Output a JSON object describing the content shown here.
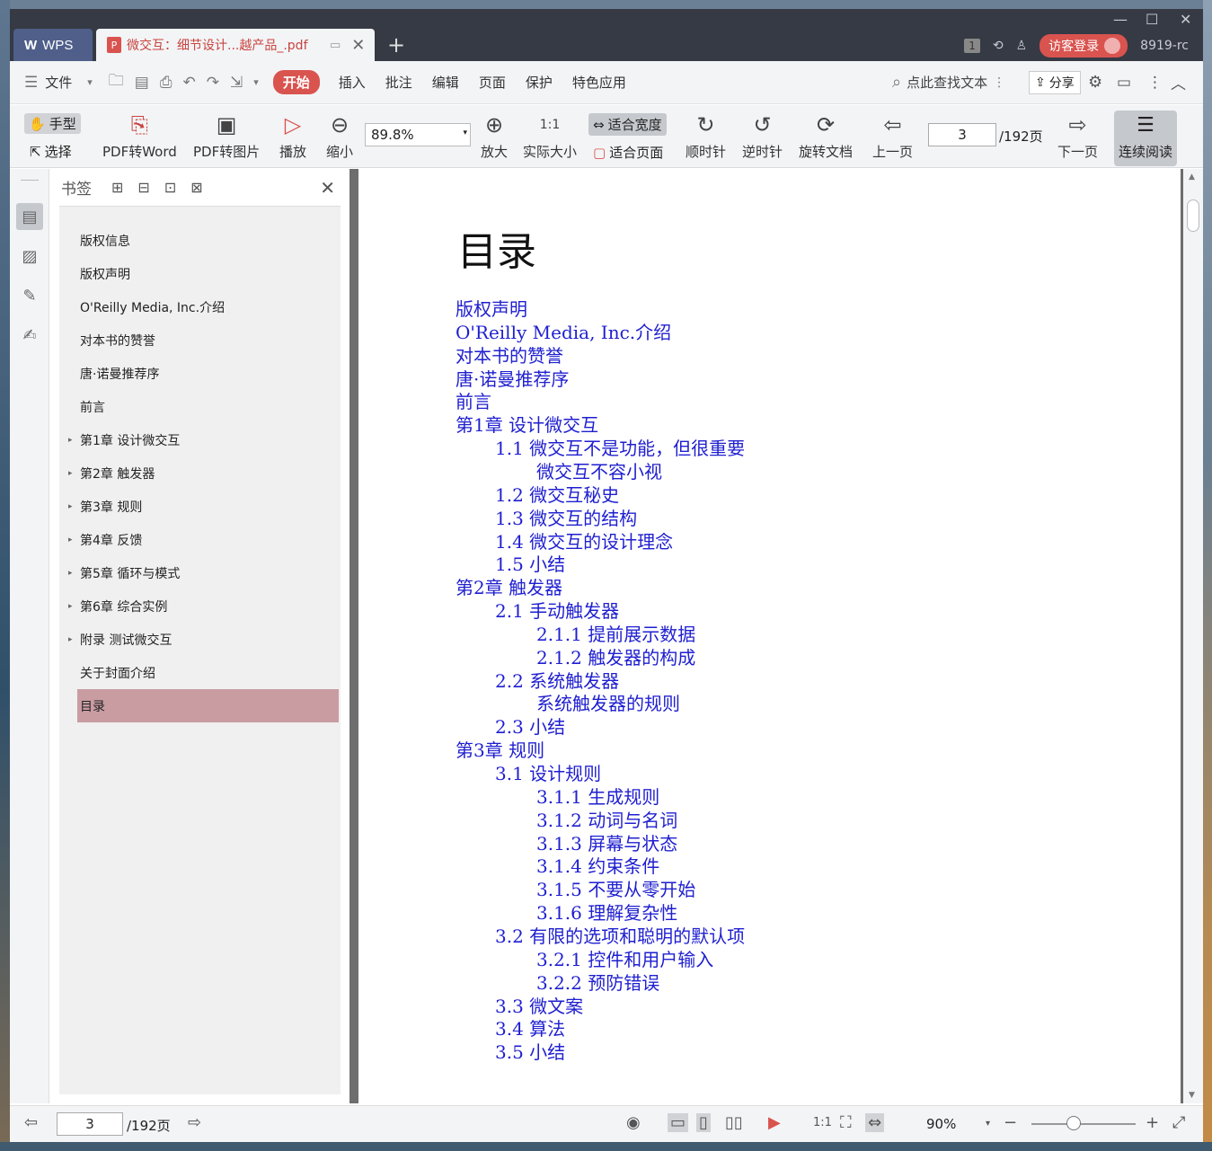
{
  "titlebar": {
    "wps_tab": "WPS",
    "doc_tab": "微交互：细节设计...越产品_.pdf",
    "badge": "1",
    "login": "访客登录",
    "version": "8919-rc"
  },
  "menu": {
    "file": "文件",
    "tabs": [
      "开始",
      "插入",
      "批注",
      "编辑",
      "页面",
      "保护",
      "特色应用"
    ],
    "search": "点此查找文本",
    "share": "分享"
  },
  "toolbar": {
    "hand": "手型",
    "select": "选择",
    "pdf_to_word": "PDF转Word",
    "pdf_to_image": "PDF转图片",
    "play": "播放",
    "zoom_out": "缩小",
    "zoom_value": "89.8%",
    "zoom_in": "放大",
    "actual_size": "实际大小",
    "fit_width": "适合宽度",
    "fit_page": "适合页面",
    "clockwise": "顺时针",
    "counterclockwise": "逆时针",
    "rotate_doc": "旋转文档",
    "prev_page": "上一页",
    "page_current": "3",
    "page_total": "/192页",
    "next_page": "下一页",
    "continuous": "连续阅读"
  },
  "bookmarks": {
    "title": "书签",
    "items": [
      {
        "label": "版权信息",
        "expandable": false
      },
      {
        "label": "版权声明",
        "expandable": false
      },
      {
        "label": "O'Reilly Media, Inc.介绍",
        "expandable": false
      },
      {
        "label": "对本书的赞誉",
        "expandable": false
      },
      {
        "label": "唐·诺曼推荐序",
        "expandable": false
      },
      {
        "label": "前言",
        "expandable": false
      },
      {
        "label": "第1章 设计微交互",
        "expandable": true
      },
      {
        "label": "第2章 触发器",
        "expandable": true
      },
      {
        "label": "第3章 规则",
        "expandable": true
      },
      {
        "label": "第4章 反馈",
        "expandable": true
      },
      {
        "label": "第5章 循环与模式",
        "expandable": true
      },
      {
        "label": "第6章 综合实例",
        "expandable": true
      },
      {
        "label": "附录 测试微交互",
        "expandable": true
      },
      {
        "label": "关于封面介绍",
        "expandable": false
      },
      {
        "label": "目录",
        "expandable": false,
        "selected": true
      }
    ]
  },
  "document": {
    "title": "目录",
    "toc": [
      {
        "text": "版权声明",
        "level": 0
      },
      {
        "text": "O'Reilly Media, Inc.介绍",
        "level": 0
      },
      {
        "text": "对本书的赞誉",
        "level": 0
      },
      {
        "text": "唐·诺曼推荐序",
        "level": 0
      },
      {
        "text": "前言",
        "level": 0
      },
      {
        "text": "第1章 设计微交互",
        "level": 0
      },
      {
        "text": "1.1 微交互不是功能，但很重要",
        "level": 1
      },
      {
        "text": "微交互不容小视",
        "level": 2
      },
      {
        "text": "1.2 微交互秘史",
        "level": 1
      },
      {
        "text": "1.3 微交互的结构",
        "level": 1
      },
      {
        "text": "1.4 微交互的设计理念",
        "level": 1
      },
      {
        "text": "1.5 小结",
        "level": 1
      },
      {
        "text": "第2章 触发器",
        "level": 0
      },
      {
        "text": "2.1 手动触发器",
        "level": 1
      },
      {
        "text": "2.1.1 提前展示数据",
        "level": 2
      },
      {
        "text": "2.1.2 触发器的构成",
        "level": 2
      },
      {
        "text": "2.2 系统触发器",
        "level": 1
      },
      {
        "text": "系统触发器的规则",
        "level": 2
      },
      {
        "text": "2.3 小结",
        "level": 1
      },
      {
        "text": "第3章 规则",
        "level": 0
      },
      {
        "text": "3.1 设计规则",
        "level": 1
      },
      {
        "text": "3.1.1 生成规则",
        "level": 2
      },
      {
        "text": "3.1.2 动词与名词",
        "level": 2
      },
      {
        "text": "3.1.3 屏幕与状态",
        "level": 2
      },
      {
        "text": "3.1.4 约束条件",
        "level": 2
      },
      {
        "text": "3.1.5 不要从零开始",
        "level": 2
      },
      {
        "text": "3.1.6 理解复杂性",
        "level": 2
      },
      {
        "text": "3.2 有限的选项和聪明的默认项",
        "level": 1
      },
      {
        "text": "3.2.1 控件和用户输入",
        "level": 2
      },
      {
        "text": "3.2.2 预防错误",
        "level": 2
      },
      {
        "text": "3.3 微文案",
        "level": 1
      },
      {
        "text": "3.4 算法",
        "level": 1
      },
      {
        "text": "3.5 小结",
        "level": 1
      }
    ]
  },
  "status": {
    "page_current": "3",
    "page_total": "/192页",
    "zoom": "90%",
    "zoom_fraction": 0.45
  },
  "colors": {
    "accent": "#d9534f",
    "link": "#1f1fd0",
    "selected_bookmark": "#c99ca2"
  }
}
